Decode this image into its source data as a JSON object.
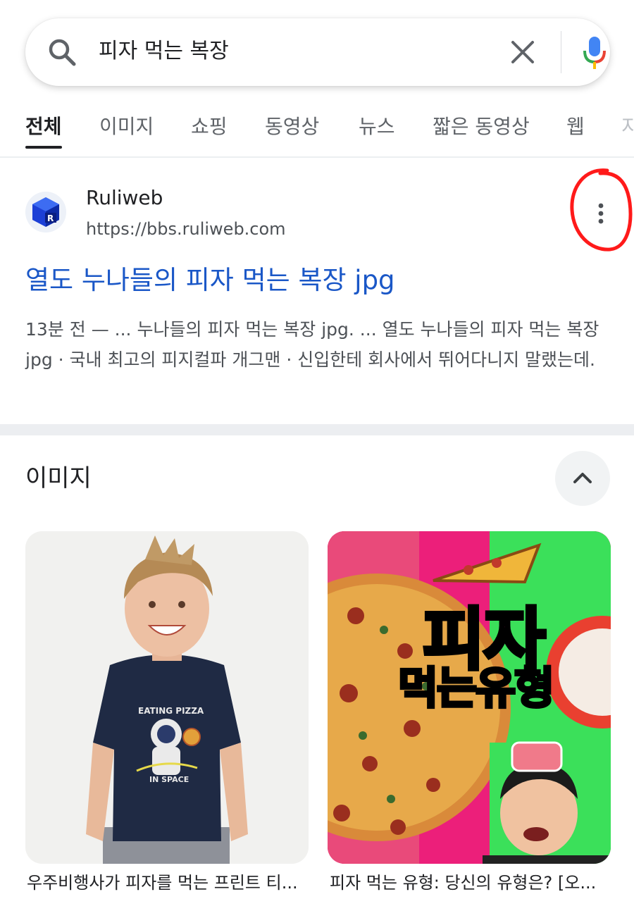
{
  "search": {
    "query": "피자 먹는 복장"
  },
  "tabs": [
    {
      "label": "전체",
      "active": true
    },
    {
      "label": "이미지"
    },
    {
      "label": "쇼핑"
    },
    {
      "label": "동영상"
    },
    {
      "label": "뉴스"
    },
    {
      "label": "짧은 동영상"
    },
    {
      "label": "웹"
    },
    {
      "label": "지"
    }
  ],
  "result": {
    "site_name": "Ruliweb",
    "url": "https://bbs.ruliweb.com",
    "title": "열도 누나들의 피자 먹는 복장 jpg",
    "snippet": "13분 전 — ... 누나들의 피자 먹는 복장 jpg. ... 열도 누나들의 피자 먹는 복장 jpg · 국내 최고의 피지컬파 개그맨 · 신입한테 회사에서 뛰어다니지 말랬는데."
  },
  "images_section": {
    "heading": "이미지",
    "cards": [
      {
        "caption": "우주비행사가 피자를 먹는 프린트 티...",
        "shirt_text_top": "EATING PIZZA",
        "shirt_text_bottom": "IN SPACE"
      },
      {
        "caption": "피자 먹는 유형: 당신의 유형은? [오...",
        "poster_line_1": "피자",
        "poster_line_2": "먹는유형"
      }
    ]
  },
  "colors": {
    "link": "#1a57c7",
    "annotation": "#ff1a1a",
    "poster_pink": "#ec1f7a",
    "poster_green": "#3be05a"
  }
}
